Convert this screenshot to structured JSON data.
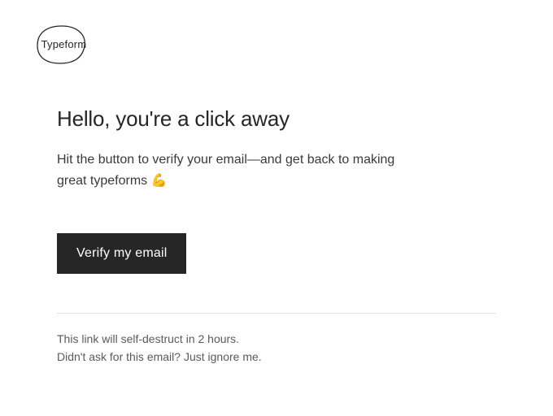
{
  "logo": {
    "text": "Typeform"
  },
  "content": {
    "heading": "Hello, you're a click away",
    "body": "Hit the button to verify your email—and get back to making great typeforms 💪",
    "cta_label": "Verify my email"
  },
  "footer": {
    "line1": "This link will self-destruct in 2 hours.",
    "line2": "Didn't ask for this email? Just ignore me."
  }
}
